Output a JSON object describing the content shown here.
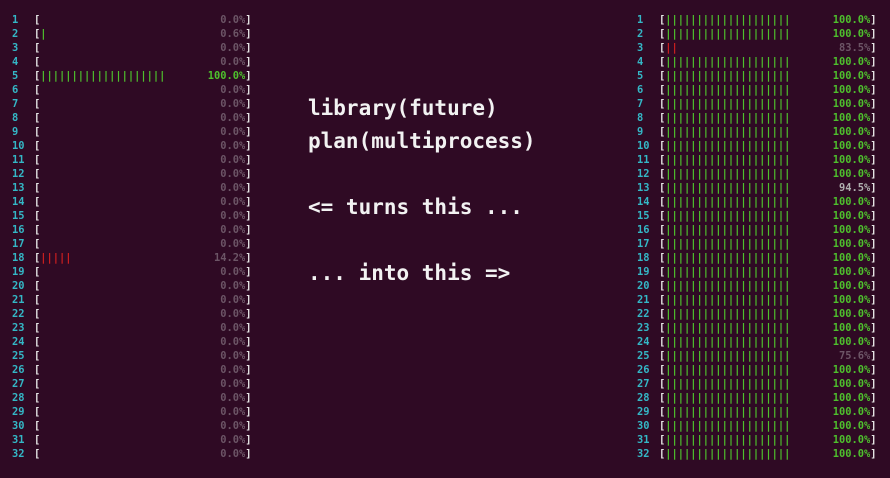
{
  "left_cpus": [
    {
      "id": "1",
      "bar": "",
      "pct": "0.0%",
      "bar_color": "green"
    },
    {
      "id": "2",
      "bar": "|",
      "pct": "0.6%",
      "bar_color": "green"
    },
    {
      "id": "3",
      "bar": "",
      "pct": "0.0%",
      "bar_color": "green"
    },
    {
      "id": "4",
      "bar": "",
      "pct": "0.0%",
      "bar_color": "green"
    },
    {
      "id": "5",
      "bar": "||||||||||||||||||||",
      "pct": "100.0%",
      "bar_color": "green"
    },
    {
      "id": "6",
      "bar": "",
      "pct": "0.0%",
      "bar_color": "green"
    },
    {
      "id": "7",
      "bar": "",
      "pct": "0.0%",
      "bar_color": "green"
    },
    {
      "id": "8",
      "bar": "",
      "pct": "0.0%",
      "bar_color": "green"
    },
    {
      "id": "9",
      "bar": "",
      "pct": "0.0%",
      "bar_color": "green"
    },
    {
      "id": "10",
      "bar": "",
      "pct": "0.0%",
      "bar_color": "green"
    },
    {
      "id": "11",
      "bar": "",
      "pct": "0.0%",
      "bar_color": "green"
    },
    {
      "id": "12",
      "bar": "",
      "pct": "0.0%",
      "bar_color": "green"
    },
    {
      "id": "13",
      "bar": "",
      "pct": "0.0%",
      "bar_color": "green"
    },
    {
      "id": "14",
      "bar": "",
      "pct": "0.0%",
      "bar_color": "green"
    },
    {
      "id": "15",
      "bar": "",
      "pct": "0.0%",
      "bar_color": "green"
    },
    {
      "id": "16",
      "bar": "",
      "pct": "0.0%",
      "bar_color": "green"
    },
    {
      "id": "17",
      "bar": "",
      "pct": "0.0%",
      "bar_color": "green"
    },
    {
      "id": "18",
      "bar": "|||||",
      "pct": "14.2%",
      "bar_color": "red"
    },
    {
      "id": "19",
      "bar": "",
      "pct": "0.0%",
      "bar_color": "green"
    },
    {
      "id": "20",
      "bar": "",
      "pct": "0.0%",
      "bar_color": "green"
    },
    {
      "id": "21",
      "bar": "",
      "pct": "0.0%",
      "bar_color": "green"
    },
    {
      "id": "22",
      "bar": "",
      "pct": "0.0%",
      "bar_color": "green"
    },
    {
      "id": "23",
      "bar": "",
      "pct": "0.0%",
      "bar_color": "green"
    },
    {
      "id": "24",
      "bar": "",
      "pct": "0.0%",
      "bar_color": "green"
    },
    {
      "id": "25",
      "bar": "",
      "pct": "0.0%",
      "bar_color": "green"
    },
    {
      "id": "26",
      "bar": "",
      "pct": "0.0%",
      "bar_color": "green"
    },
    {
      "id": "27",
      "bar": "",
      "pct": "0.0%",
      "bar_color": "green"
    },
    {
      "id": "28",
      "bar": "",
      "pct": "0.0%",
      "bar_color": "green"
    },
    {
      "id": "29",
      "bar": "",
      "pct": "0.0%",
      "bar_color": "green"
    },
    {
      "id": "30",
      "bar": "",
      "pct": "0.0%",
      "bar_color": "green"
    },
    {
      "id": "31",
      "bar": "",
      "pct": "0.0%",
      "bar_color": "green"
    },
    {
      "id": "32",
      "bar": "",
      "pct": "0.0%",
      "bar_color": "green"
    }
  ],
  "right_cpus": [
    {
      "id": "1",
      "bar": "||||||||||||||||||||",
      "pct": "100.0%",
      "bar_color": "green"
    },
    {
      "id": "2",
      "bar": "||||||||||||||||||||",
      "pct": "100.0%",
      "bar_color": "green"
    },
    {
      "id": "3",
      "bar": "||||||||||||||||||||",
      "pct": "83.5%",
      "bar_color": "green",
      "tail": "||",
      "tail_color": "red"
    },
    {
      "id": "4",
      "bar": "||||||||||||||||||||",
      "pct": "100.0%",
      "bar_color": "green"
    },
    {
      "id": "5",
      "bar": "||||||||||||||||||||",
      "pct": "100.0%",
      "bar_color": "green"
    },
    {
      "id": "6",
      "bar": "||||||||||||||||||||",
      "pct": "100.0%",
      "bar_color": "green"
    },
    {
      "id": "7",
      "bar": "||||||||||||||||||||",
      "pct": "100.0%",
      "bar_color": "green"
    },
    {
      "id": "8",
      "bar": "||||||||||||||||||||",
      "pct": "100.0%",
      "bar_color": "green"
    },
    {
      "id": "9",
      "bar": "||||||||||||||||||||",
      "pct": "100.0%",
      "bar_color": "green"
    },
    {
      "id": "10",
      "bar": "||||||||||||||||||||",
      "pct": "100.0%",
      "bar_color": "green"
    },
    {
      "id": "11",
      "bar": "||||||||||||||||||||",
      "pct": "100.0%",
      "bar_color": "green"
    },
    {
      "id": "12",
      "bar": "||||||||||||||||||||",
      "pct": "100.0%",
      "bar_color": "green"
    },
    {
      "id": "13",
      "bar": "||||||||||||||||||||",
      "pct": "94.5%",
      "bar_color": "green"
    },
    {
      "id": "14",
      "bar": "||||||||||||||||||||",
      "pct": "100.0%",
      "bar_color": "green"
    },
    {
      "id": "15",
      "bar": "||||||||||||||||||||",
      "pct": "100.0%",
      "bar_color": "green"
    },
    {
      "id": "16",
      "bar": "||||||||||||||||||||",
      "pct": "100.0%",
      "bar_color": "green"
    },
    {
      "id": "17",
      "bar": "||||||||||||||||||||",
      "pct": "100.0%",
      "bar_color": "green"
    },
    {
      "id": "18",
      "bar": "||||||||||||||||||||",
      "pct": "100.0%",
      "bar_color": "green"
    },
    {
      "id": "19",
      "bar": "||||||||||||||||||||",
      "pct": "100.0%",
      "bar_color": "green"
    },
    {
      "id": "20",
      "bar": "||||||||||||||||||||",
      "pct": "100.0%",
      "bar_color": "green"
    },
    {
      "id": "21",
      "bar": "||||||||||||||||||||",
      "pct": "100.0%",
      "bar_color": "green"
    },
    {
      "id": "22",
      "bar": "||||||||||||||||||||",
      "pct": "100.0%",
      "bar_color": "green"
    },
    {
      "id": "23",
      "bar": "||||||||||||||||||||",
      "pct": "100.0%",
      "bar_color": "green"
    },
    {
      "id": "24",
      "bar": "||||||||||||||||||||",
      "pct": "100.0%",
      "bar_color": "green"
    },
    {
      "id": "25",
      "bar": "||||||||||||||||||||",
      "pct": "75.6%",
      "bar_color": "green"
    },
    {
      "id": "26",
      "bar": "||||||||||||||||||||",
      "pct": "100.0%",
      "bar_color": "green"
    },
    {
      "id": "27",
      "bar": "||||||||||||||||||||",
      "pct": "100.0%",
      "bar_color": "green"
    },
    {
      "id": "28",
      "bar": "||||||||||||||||||||",
      "pct": "100.0%",
      "bar_color": "green"
    },
    {
      "id": "29",
      "bar": "||||||||||||||||||||",
      "pct": "100.0%",
      "bar_color": "green"
    },
    {
      "id": "30",
      "bar": "||||||||||||||||||||",
      "pct": "100.0%",
      "bar_color": "green"
    },
    {
      "id": "31",
      "bar": "||||||||||||||||||||",
      "pct": "100.0%",
      "bar_color": "green"
    },
    {
      "id": "32",
      "bar": "||||||||||||||||||||",
      "pct": "100.0%",
      "bar_color": "green"
    }
  ],
  "caption": {
    "line1": "library(future)",
    "line2": "plan(multiprocess)",
    "line3": "<= turns this ...",
    "line4": "... into this =>"
  },
  "colors": {
    "background": "#2f0a24",
    "cpu_number": "#34b7c6",
    "bar_green": "#4ec02d",
    "bar_red": "#cf1f1f",
    "pct_dim": "#6c5566",
    "bracket": "#e6e6e6"
  }
}
